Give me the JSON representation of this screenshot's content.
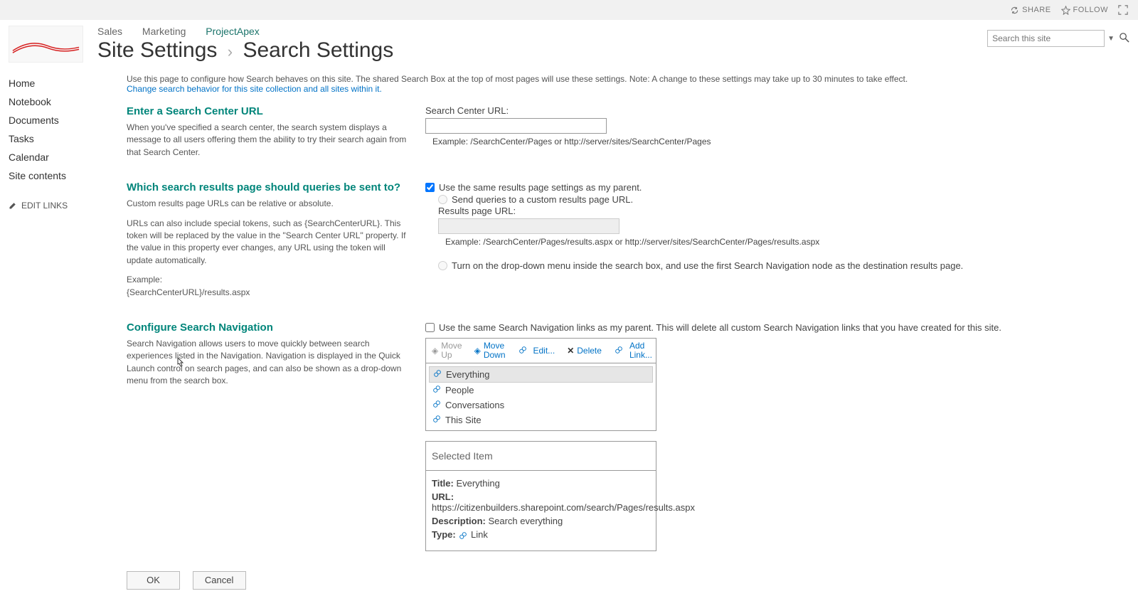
{
  "ribbon": {
    "share": "SHARE",
    "follow": "FOLLOW"
  },
  "topnav": {
    "items": [
      "Sales",
      "Marketing",
      "ProjectApex"
    ],
    "activeIndex": 2
  },
  "breadcrumb": {
    "part1": "Site Settings",
    "part2": "Search Settings"
  },
  "search": {
    "placeholder": "Search this site"
  },
  "leftnav": {
    "items": [
      "Home",
      "Notebook",
      "Documents",
      "Tasks",
      "Calendar",
      "Site contents"
    ],
    "edit": "EDIT LINKS"
  },
  "intro": {
    "text": "Use this page to configure how Search behaves on this site. The shared Search Box at the top of most pages will use these settings. Note: A change to these settings may take up to 30 minutes to take effect.",
    "link": "Change search behavior for this site collection and all sites within it."
  },
  "section1": {
    "title": "Enter a Search Center URL",
    "desc": "When you've specified a search center, the search system displays a message to all users offering them the ability to try their search again from that Search Center.",
    "label": "Search Center URL:",
    "value": "",
    "hint": "Example: /SearchCenter/Pages or http://server/sites/SearchCenter/Pages"
  },
  "section2": {
    "title": "Which search results page should queries be sent to?",
    "desc1": "Custom results page URLs can be relative or absolute.",
    "desc2": "URLs can also include special tokens, such as {SearchCenterURL}. This token will be replaced by the value in the \"Search Center URL\" property. If the value in this property ever changes, any URL using the token will update automatically.",
    "desc3a": "Example:",
    "desc3b": "{SearchCenterURL}/results.aspx",
    "opt1": "Use the same results page settings as my parent.",
    "opt2": "Send queries to a custom results page URL.",
    "resultsLabel": "Results page URL:",
    "resultsHint": "Example: /SearchCenter/Pages/results.aspx or http://server/sites/SearchCenter/Pages/results.aspx",
    "opt3": "Turn on the drop-down menu inside the search box, and use the first Search Navigation node as the destination results page."
  },
  "section3": {
    "title": "Configure Search Navigation",
    "desc": "Search Navigation allows users to move quickly between search experiences listed in the Navigation. Navigation is displayed in the Quick Launch control on search pages, and can also be shown as a drop-down menu from the search box.",
    "sameAsParent": "Use the same Search Navigation links as my parent. This will delete all custom Search Navigation links that you have created for this site.",
    "toolbar": {
      "moveUp": "Move Up",
      "moveDown1": "Move",
      "moveDown2": "Down",
      "edit": "Edit...",
      "delete": "Delete",
      "add1": "Add",
      "add2": "Link..."
    },
    "items": [
      "Everything",
      "People",
      "Conversations",
      "This Site"
    ],
    "selectedHeader": "Selected Item",
    "selected": {
      "titleK": "Title:",
      "titleV": "Everything",
      "urlK": "URL:",
      "urlV": "https://citizenbuilders.sharepoint.com/search/Pages/results.aspx",
      "descK": "Description:",
      "descV": "Search everything",
      "typeK": "Type:",
      "typeV": "Link"
    }
  },
  "buttons": {
    "ok": "OK",
    "cancel": "Cancel"
  }
}
